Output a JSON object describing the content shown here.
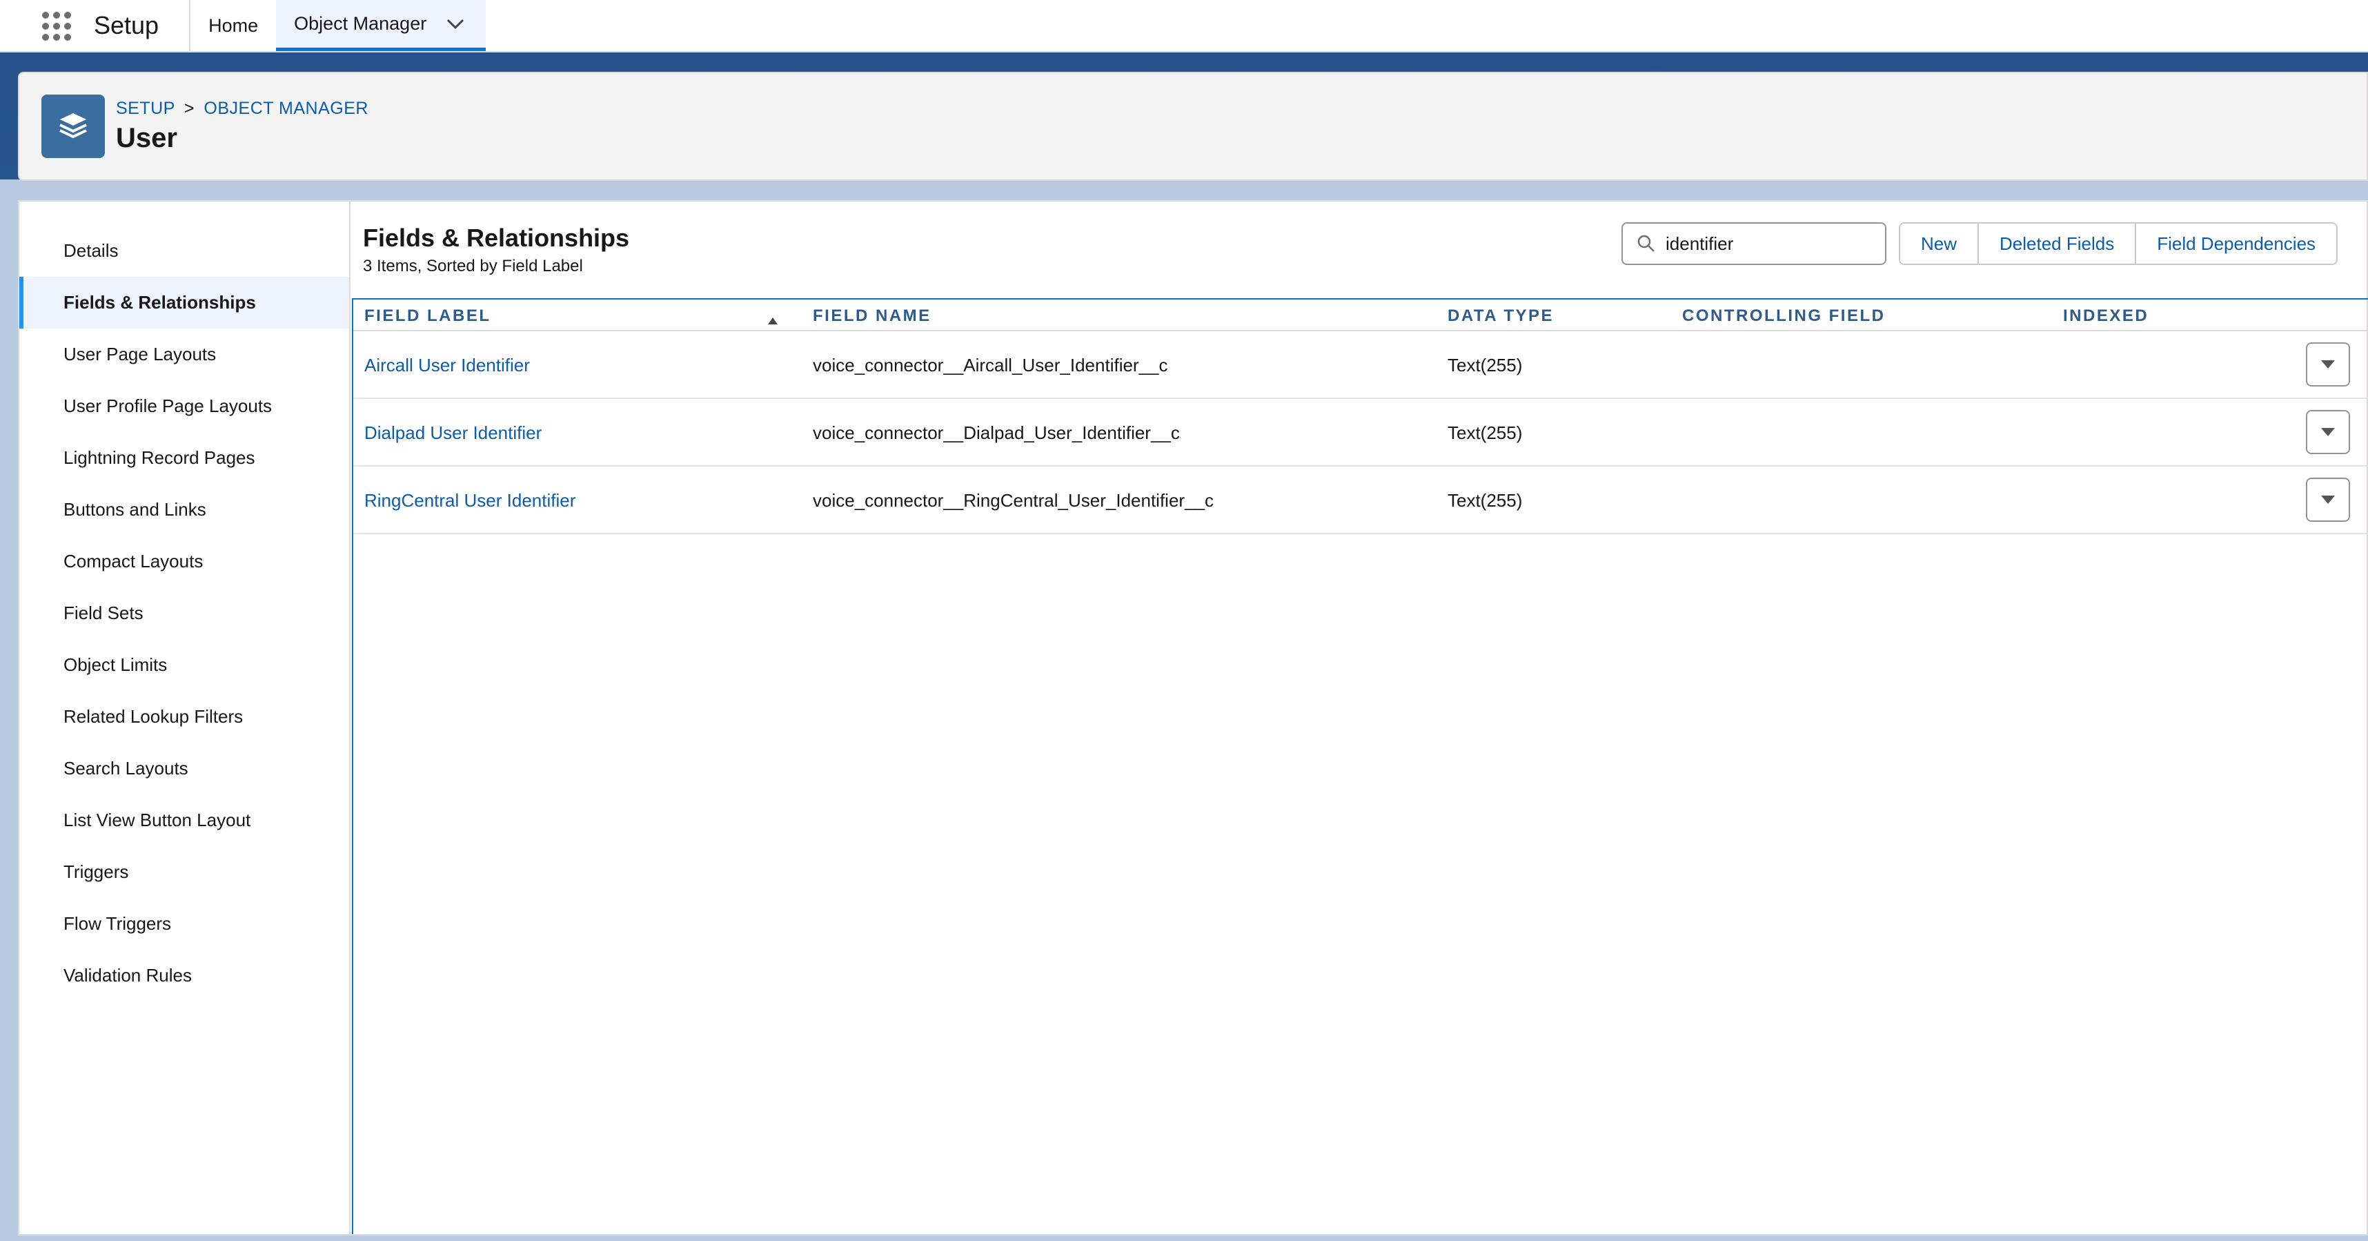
{
  "topbar": {
    "app_name": "Setup",
    "nav": [
      {
        "label": "Home"
      },
      {
        "label": "Object Manager"
      }
    ]
  },
  "header": {
    "breadcrumb": [
      "SETUP",
      "OBJECT MANAGER"
    ],
    "breadcrumb_separator": ">",
    "title": "User",
    "icon": "layers-icon"
  },
  "sidebar": {
    "items": [
      {
        "label": "Details"
      },
      {
        "label": "Fields & Relationships",
        "active": true
      },
      {
        "label": "User Page Layouts"
      },
      {
        "label": "User Profile Page Layouts"
      },
      {
        "label": "Lightning Record Pages"
      },
      {
        "label": "Buttons and Links"
      },
      {
        "label": "Compact Layouts"
      },
      {
        "label": "Field Sets"
      },
      {
        "label": "Object Limits"
      },
      {
        "label": "Related Lookup Filters"
      },
      {
        "label": "Search Layouts"
      },
      {
        "label": "List View Button Layout"
      },
      {
        "label": "Triggers"
      },
      {
        "label": "Flow Triggers"
      },
      {
        "label": "Validation Rules"
      }
    ]
  },
  "main": {
    "title": "Fields & Relationships",
    "subtitle": "3 Items, Sorted by Field Label",
    "search": {
      "value": "identifier"
    },
    "buttons": {
      "new": "New",
      "deleted_fields": "Deleted Fields",
      "field_dependencies": "Field Dependencies"
    },
    "table": {
      "columns": [
        "FIELD LABEL",
        "FIELD NAME",
        "DATA TYPE",
        "CONTROLLING FIELD",
        "INDEXED"
      ],
      "rows": [
        {
          "label": "Aircall User Identifier",
          "name": "voice_connector__Aircall_User_Identifier__c",
          "type": "Text(255)",
          "controlling": "",
          "indexed": ""
        },
        {
          "label": "Dialpad User Identifier",
          "name": "voice_connector__Dialpad_User_Identifier__c",
          "type": "Text(255)",
          "controlling": "",
          "indexed": ""
        },
        {
          "label": "RingCentral User Identifier",
          "name": "voice_connector__RingCentral_User_Identifier__c",
          "type": "Text(255)",
          "controlling": "",
          "indexed": ""
        }
      ]
    }
  },
  "colors": {
    "link": "#0b5cab",
    "brand_band": "#2e5a8c",
    "active_nav": "#0176d3"
  }
}
